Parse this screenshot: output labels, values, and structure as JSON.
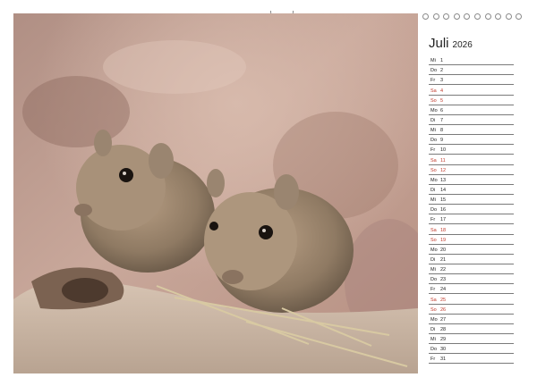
{
  "calendar": {
    "month": "Juli",
    "year": "2026",
    "days": [
      {
        "weekday": "Mi",
        "date": "1",
        "weekend": false
      },
      {
        "weekday": "Do",
        "date": "2",
        "weekend": false
      },
      {
        "weekday": "Fr",
        "date": "3",
        "weekend": false
      },
      {
        "weekday": "Sa",
        "date": "4",
        "weekend": true
      },
      {
        "weekday": "So",
        "date": "5",
        "weekend": true
      },
      {
        "weekday": "Mo",
        "date": "6",
        "weekend": false
      },
      {
        "weekday": "Di",
        "date": "7",
        "weekend": false
      },
      {
        "weekday": "Mi",
        "date": "8",
        "weekend": false
      },
      {
        "weekday": "Do",
        "date": "9",
        "weekend": false
      },
      {
        "weekday": "Fr",
        "date": "10",
        "weekend": false
      },
      {
        "weekday": "Sa",
        "date": "11",
        "weekend": true
      },
      {
        "weekday": "So",
        "date": "12",
        "weekend": true
      },
      {
        "weekday": "Mo",
        "date": "13",
        "weekend": false
      },
      {
        "weekday": "Di",
        "date": "14",
        "weekend": false
      },
      {
        "weekday": "Mi",
        "date": "15",
        "weekend": false
      },
      {
        "weekday": "Do",
        "date": "16",
        "weekend": false
      },
      {
        "weekday": "Fr",
        "date": "17",
        "weekend": false
      },
      {
        "weekday": "Sa",
        "date": "18",
        "weekend": true
      },
      {
        "weekday": "So",
        "date": "19",
        "weekend": true
      },
      {
        "weekday": "Mo",
        "date": "20",
        "weekend": false
      },
      {
        "weekday": "Di",
        "date": "21",
        "weekend": false
      },
      {
        "weekday": "Mi",
        "date": "22",
        "weekend": false
      },
      {
        "weekday": "Do",
        "date": "23",
        "weekend": false
      },
      {
        "weekday": "Fr",
        "date": "24",
        "weekend": false
      },
      {
        "weekday": "Sa",
        "date": "25",
        "weekend": true
      },
      {
        "weekday": "So",
        "date": "26",
        "weekend": true
      },
      {
        "weekday": "Mo",
        "date": "27",
        "weekend": false
      },
      {
        "weekday": "Di",
        "date": "28",
        "weekend": false
      },
      {
        "weekday": "Mi",
        "date": "29",
        "weekend": false
      },
      {
        "weekday": "Do",
        "date": "30",
        "weekend": false
      },
      {
        "weekday": "Fr",
        "date": "31",
        "weekend": false
      }
    ]
  },
  "photo": {
    "subject": "two gerbils on a rock"
  },
  "colors": {
    "weekend": "#c0392b",
    "text": "#222222",
    "rule": "#7a7a7a"
  }
}
